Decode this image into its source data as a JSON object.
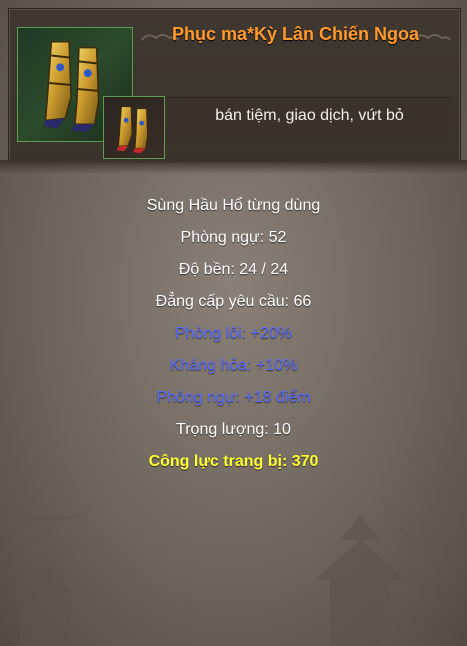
{
  "item": {
    "name": "Phục ma*Kỳ Lân Chiến Ngoa",
    "icon_large": "boots-item-icon",
    "icon_small": "boots-item-icon",
    "restriction": "bán tiệm, giao dịch, vứt bỏ"
  },
  "stats": [
    {
      "text": "Sùng Hầu Hổ từng dùng",
      "color": "white"
    },
    {
      "text": "Phòng ngự: 52",
      "color": "white"
    },
    {
      "text": "Độ bền:  24 /  24",
      "color": "white"
    },
    {
      "text": "Đẳng cấp yêu cầu: 66",
      "color": "white"
    },
    {
      "text": "Phòng lôi: +20%",
      "color": "blue"
    },
    {
      "text": "Kháng hỏa: +10%",
      "color": "blue"
    },
    {
      "text": "Phòng ngự: +18 điểm",
      "color": "blue"
    },
    {
      "text": "Trọng lượng: 10",
      "color": "white"
    },
    {
      "text": "Công lực trang bị: 370",
      "color": "yellow"
    }
  ],
  "colors": {
    "title": "#ff9a2e",
    "stat_white": "#ffffff",
    "stat_blue": "#5a6cff",
    "stat_yellow": "#ffff33"
  }
}
